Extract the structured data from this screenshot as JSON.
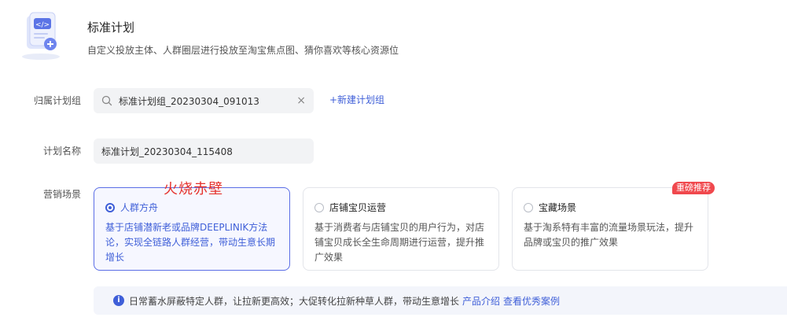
{
  "header": {
    "icon": "plan-document-icon",
    "title": "标准计划",
    "description": "自定义投放主体、人群圈层进行投放至淘宝焦点图、猜你喜欢等核心资源位"
  },
  "form": {
    "group": {
      "label": "归属计划组",
      "value": "标准计划组_20230304_091013",
      "search_icon": "search-icon",
      "clear_icon": "close-icon",
      "clear_glyph": "×",
      "new_link": "+新建计划组"
    },
    "name": {
      "label": "计划名称",
      "value": "标准计划_20230304_115408"
    },
    "scene": {
      "label": "营销场景",
      "options": [
        {
          "title": "人群方舟",
          "desc": "基于店铺潜新老或品牌DEEPLINIK方法论，实现全链路人群经营，带动生意长期增长",
          "selected": true
        },
        {
          "title": "店铺宝贝运营",
          "desc": "基于消费者与店铺宝贝的用户行为，对店铺宝贝成长全生命周期进行运营，提升推广效果",
          "selected": false
        },
        {
          "title": "宝藏场景",
          "desc": "基于淘系特有丰富的流量场景玩法，提升品牌或宝贝的推广效果",
          "selected": false,
          "badge": "重磅推荐"
        }
      ]
    }
  },
  "watermark": "火烧赤壁",
  "info": {
    "icon": "info-icon",
    "icon_glyph": "i",
    "text": "日常蓄水屏蔽特定人群，让拉新更高效；大促转化拉新种草人群，带动生意增长",
    "link1": "产品介绍",
    "link2": "查看优秀案例"
  },
  "colors": {
    "accent": "#3f5fd8",
    "badge": "#f0484d",
    "watermark": "#e5322d"
  }
}
